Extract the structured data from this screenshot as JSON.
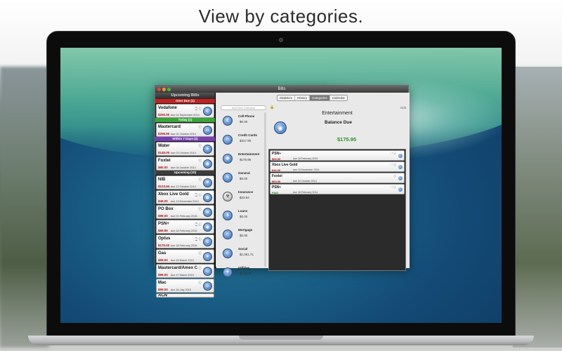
{
  "headline": "View by categories.",
  "window": {
    "title": "Bills",
    "tabs": [
      "Statistics",
      "History",
      "Categories",
      "Calendar"
    ],
    "active_tab": "Categories"
  },
  "left_pane": {
    "header": "Upcoming Bills",
    "sections": {
      "overdue": "Over Due (1)",
      "today": "Today (1)",
      "within7": "Within 7 Days (2)",
      "upcoming": "Upcoming (10)"
    },
    "bills": [
      {
        "name": "Vodafone",
        "amount": "$250.00",
        "due": "due 04 September 2014"
      },
      {
        "name": "Mastercard",
        "amount": "$258.90",
        "due": "due 01 October 2014"
      },
      {
        "name": "Water",
        "amount": "$145.00",
        "due": "due 03 October 2014"
      },
      {
        "name": "Foxtel",
        "amount": "$60.00",
        "due": "due 04 October 2014"
      },
      {
        "name": "NIB",
        "amount": "$123.64",
        "due": "due 12 October 2014"
      },
      {
        "name": "Xbox Live Gold",
        "amount": "$46.00",
        "due": "due 13 December 2014"
      },
      {
        "name": "PO Box",
        "amount": "$99.00",
        "due": "due 01 February 2015"
      },
      {
        "name": "PSN+",
        "amount": "$69.95",
        "due": "due 18 February 2015"
      },
      {
        "name": "Optus",
        "amount": "$175.00",
        "due": "due 18 February 2015"
      },
      {
        "name": "Gas",
        "amount": "$99.00",
        "due": "due 23 March 2015"
      },
      {
        "name": "Mastercard/Amex C",
        "amount": "$99.00",
        "due": "due 27 March 2015"
      },
      {
        "name": "Mac",
        "amount": "$99.00",
        "due": "due 16 July 2015"
      },
      {
        "name": "ACN",
        "amount": "",
        "due": ""
      }
    ]
  },
  "categories_pane": {
    "add_placeholder": "Add New Category",
    "edit_label": "Edit",
    "categories": [
      {
        "name": "Cell Phone",
        "amount": "$0.00"
      },
      {
        "name": "Credit Cards",
        "amount": "$317.90"
      },
      {
        "name": "Entertainment",
        "amount": "$175.95"
      },
      {
        "name": "General",
        "amount": "$0.00"
      },
      {
        "name": "Insurance",
        "amount": "$23.64"
      },
      {
        "name": "Loans",
        "amount": "$0.00"
      },
      {
        "name": "Mortgage",
        "amount": "$0.00"
      },
      {
        "name": "Social",
        "amount": "$1,061.71"
      },
      {
        "name": "Utilities",
        "amount": "$149.00"
      }
    ]
  },
  "detail": {
    "title": "Entertainment",
    "balance_label": "Balance Due",
    "balance_value": "$175.95",
    "bills": [
      {
        "name": "PSN+",
        "amount": "$69.95",
        "due": "due 18 February 2015",
        "paid": false
      },
      {
        "name": "Xbox Live Gold",
        "amount": "$46.00",
        "due": "due 13 December 2014",
        "paid": false
      },
      {
        "name": "Foxtel",
        "amount": "$60.00",
        "due": "due 04 October 2014",
        "paid": false
      },
      {
        "name": "PSN+",
        "amount": "PAID",
        "due": "due 18 February 2014",
        "paid": true
      }
    ]
  },
  "colors": {
    "overdue": "#c62020",
    "today": "#3da53a",
    "within7": "#7a3fb8",
    "balance": "#2e8b2e"
  }
}
